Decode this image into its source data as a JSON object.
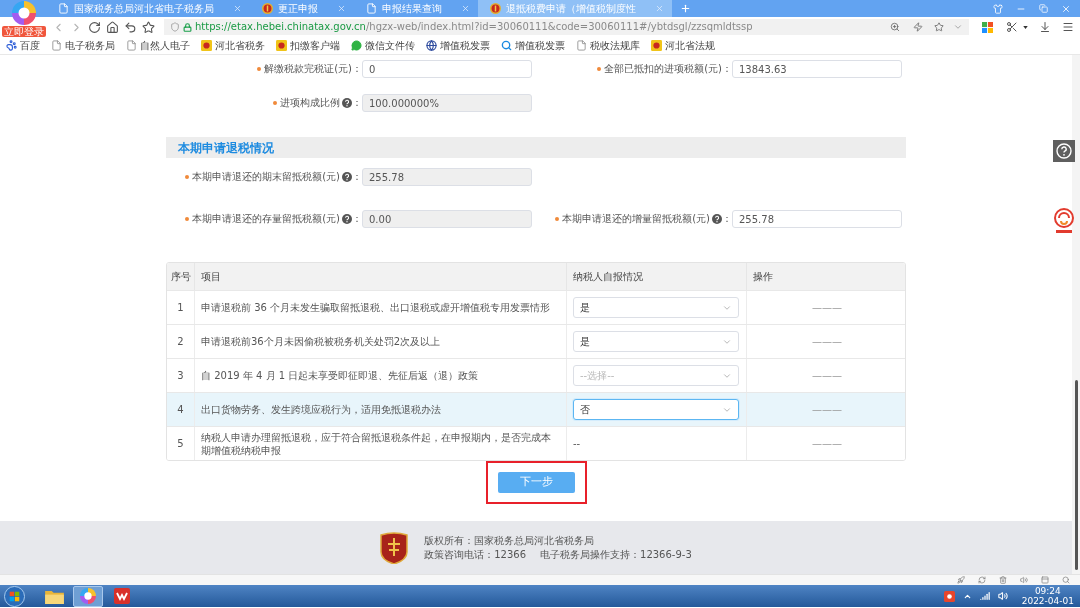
{
  "browser": {
    "login_badge": "立即登录",
    "tabs": [
      {
        "title": "国家税务总局河北省电子税务局",
        "kind": "page",
        "selected": false
      },
      {
        "title": "更正申报",
        "kind": "emblem",
        "selected": false
      },
      {
        "title": "申报结果查询",
        "kind": "page",
        "selected": false
      },
      {
        "title": "退抵税费申请（增值税制度性",
        "kind": "emblem",
        "selected": true
      }
    ],
    "address": {
      "host": "https://etax.hebei.chinatax.gov.cn",
      "path": "/hgzx-web/index.html?id=30060111&code=30060111#/ybtdsgl/zzsqmldtssp"
    },
    "bookmarks": [
      {
        "label": "百度",
        "kind": "paw"
      },
      {
        "label": "电子税务局",
        "kind": "page"
      },
      {
        "label": "自然人电子",
        "kind": "page"
      },
      {
        "label": "河北省税务",
        "kind": "emblem"
      },
      {
        "label": "扣缴客户端",
        "kind": "emblem"
      },
      {
        "label": "微信文件传",
        "kind": "chat"
      },
      {
        "label": "增值税发票",
        "kind": "globe"
      },
      {
        "label": "增值税发票",
        "kind": "search"
      },
      {
        "label": "税收法规库",
        "kind": "page"
      },
      {
        "label": "河北省法规",
        "kind": "emblem"
      }
    ]
  },
  "form": {
    "rows": [
      [
        {
          "label": "解缴税款完税证(元)",
          "help": false,
          "suffix": "：",
          "value": "0",
          "disabled": false
        },
        {
          "label": "全部已抵扣的进项税额(元)",
          "help": false,
          "suffix": "：",
          "value": "13843.63",
          "disabled": false
        }
      ],
      [
        {
          "label": "进项构成比例",
          "help": true,
          "suffix": "：",
          "value": "100.000000%",
          "disabled": true
        }
      ]
    ]
  },
  "section": {
    "title": "本期申请退税情况",
    "rows": [
      [
        {
          "label": "本期申请退还的期末留抵税额(元)",
          "help": true,
          "suffix": "：",
          "value": "255.78",
          "disabled": true
        }
      ],
      [
        {
          "label": "本期申请退还的存量留抵税额(元)",
          "help": true,
          "suffix": "：",
          "value": "0.00",
          "disabled": true
        },
        {
          "label": "本期申请退还的增量留抵税额(元)",
          "help": true,
          "suffix": "：",
          "value": "255.78",
          "disabled": false
        }
      ]
    ]
  },
  "table": {
    "columns": [
      "序号",
      "项目",
      "纳税人自报情况",
      "操作"
    ],
    "rows": [
      {
        "index": "1",
        "item": "申请退税前 36 个月未发生骗取留抵退税、出口退税或虚开增值税专用发票情形",
        "answer": {
          "kind": "select",
          "value": "是",
          "focused": false
        },
        "action": "———",
        "highlighted": false
      },
      {
        "index": "2",
        "item": "申请退税前36个月未因偷税被税务机关处罚2次及以上",
        "answer": {
          "kind": "select",
          "value": "是",
          "focused": false
        },
        "action": "———",
        "highlighted": false
      },
      {
        "index": "3",
        "item": "自 2019 年 4 月 1 日起未享受即征即退、先征后返（退）政策",
        "answer": {
          "kind": "select",
          "placeholder": "--选择--",
          "focused": false
        },
        "action": "———",
        "highlighted": false
      },
      {
        "index": "4",
        "item": "出口货物劳务、发生跨境应税行为，适用免抵退税办法",
        "answer": {
          "kind": "select",
          "value": "否",
          "focused": true
        },
        "action": "———",
        "highlighted": true
      },
      {
        "index": "5",
        "item": "纳税人申请办理留抵退税，应于符合留抵退税条件起，在申报期内，是否完成本期增值税纳税申报",
        "answer": {
          "kind": "text",
          "value": "--"
        },
        "action": "———",
        "highlighted": false
      }
    ]
  },
  "next_button": {
    "label": "下一步",
    "highlighted": true
  },
  "footer": {
    "copyright": "版权所有：国家税务总局河北省税务局",
    "hotline": "政策咨询电话：12366",
    "support": "电子税务局操作支持：12366-9-3"
  },
  "taskbar": {
    "apps": [
      {
        "kind": "folder",
        "selected": false
      },
      {
        "kind": "browser",
        "selected": true
      },
      {
        "kind": "office",
        "selected": false
      }
    ],
    "time": "09:24",
    "date": "2022-04-01"
  }
}
